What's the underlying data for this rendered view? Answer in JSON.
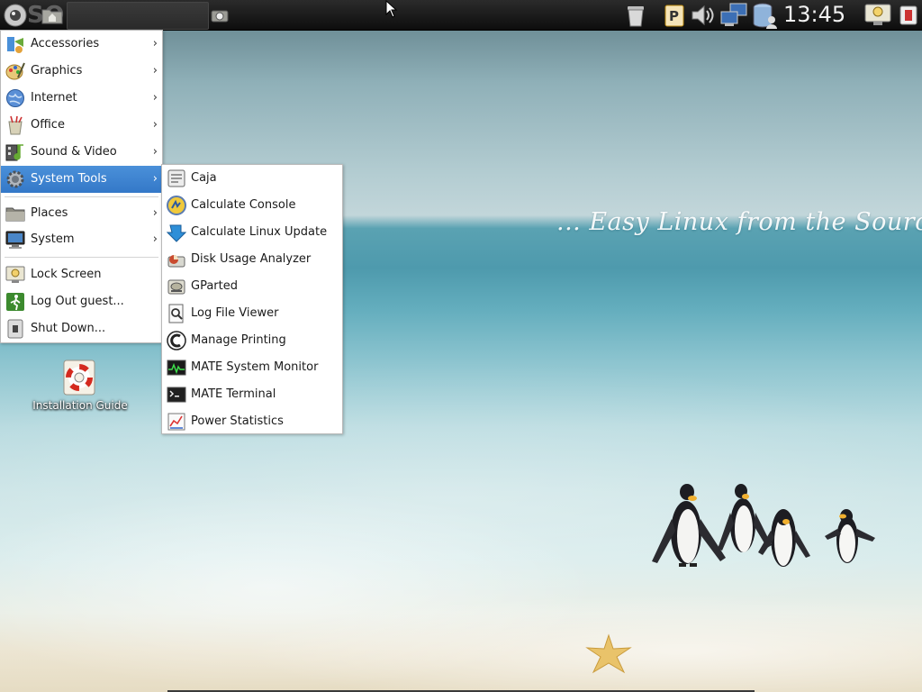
{
  "top_panel": {
    "watermark": "SOFTPEDIA",
    "clock": "13:45",
    "icons": [
      "distro-logo-icon",
      "home-folder-icon",
      "screenshot-app-icon",
      "trash-icon",
      "parcellite-clipboard-icon",
      "volume-icon",
      "network-icon",
      "user-disk-icon",
      "display-lock-icon",
      "window-list-icon"
    ]
  },
  "desktop": {
    "slogan": "... Easy Linux from the Source",
    "icons": [
      {
        "label": "Installation Guide",
        "icon": "lifebuoy-icon"
      }
    ]
  },
  "main_menu": {
    "items": [
      {
        "label": "Accessories",
        "icon": "accessories-icon",
        "arrow": "›"
      },
      {
        "label": "Graphics",
        "icon": "graphics-icon",
        "arrow": "›"
      },
      {
        "label": "Internet",
        "icon": "globe-icon",
        "arrow": "›"
      },
      {
        "label": "Office",
        "icon": "office-icon",
        "arrow": "›"
      },
      {
        "label": "Sound & Video",
        "icon": "sound-video-icon",
        "arrow": "›"
      },
      {
        "label": "System Tools",
        "icon": "gear-icon",
        "arrow": "›"
      },
      {
        "label": "Places",
        "icon": "folder-icon",
        "arrow": "›"
      },
      {
        "label": "System",
        "icon": "monitor-icon",
        "arrow": "›"
      },
      {
        "label": "Lock Screen",
        "icon": "lock-screen-icon"
      },
      {
        "label": "Log Out guest...",
        "icon": "logout-icon"
      },
      {
        "label": "Shut Down...",
        "icon": "shutdown-icon"
      }
    ],
    "selected": "System Tools"
  },
  "submenu": {
    "items": [
      {
        "label": "Caja",
        "icon": "caja-icon"
      },
      {
        "label": "Calculate Console",
        "icon": "calculate-console-icon"
      },
      {
        "label": "Calculate Linux Update",
        "icon": "update-arrow-icon"
      },
      {
        "label": "Disk Usage Analyzer",
        "icon": "disk-usage-icon"
      },
      {
        "label": "GParted",
        "icon": "gparted-icon"
      },
      {
        "label": "Log File Viewer",
        "icon": "log-viewer-icon"
      },
      {
        "label": "Manage Printing",
        "icon": "printing-icon"
      },
      {
        "label": "MATE System Monitor",
        "icon": "system-monitor-icon"
      },
      {
        "label": "MATE Terminal",
        "icon": "terminal-icon"
      },
      {
        "label": "Power Statistics",
        "icon": "power-statistics-icon"
      }
    ]
  },
  "colors": {
    "selection": "#3a80cf",
    "panel": "#141414"
  }
}
